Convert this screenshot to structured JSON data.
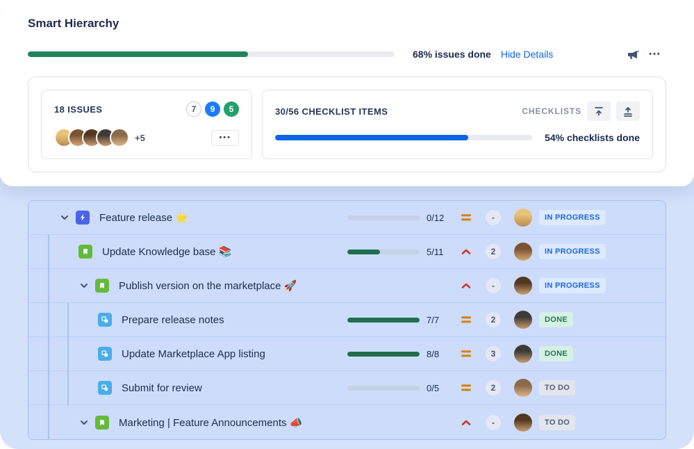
{
  "header": {
    "title": "Smart Hierarchy",
    "progress": {
      "bar_percent": 60,
      "label": "68% issues done"
    },
    "hide_details_label": "Hide Details",
    "more_label": "•••"
  },
  "summary": {
    "issues_card": {
      "title": "18 ISSUES",
      "status_badges": [
        {
          "value": "7",
          "style": "todo"
        },
        {
          "value": "9",
          "style": "inprogress"
        },
        {
          "value": "5",
          "style": "done"
        }
      ],
      "avatars": [
        "av1",
        "av2",
        "av3",
        "av4",
        "av5"
      ],
      "avatars_extra": "+5",
      "more_label": "•••"
    },
    "checklist_card": {
      "title": "30/56 CHECKLIST ITEMS",
      "checklists_label": "CHECKLISTS",
      "progress": {
        "bar_percent": 75,
        "label": "54% checklists done"
      }
    }
  },
  "table": {
    "rows": [
      {
        "depth": 0,
        "expandable": true,
        "type": "epic",
        "title": "Feature release ⭐",
        "show_progress": true,
        "progress": "0/12",
        "progress_percent": 0,
        "priority": "medium",
        "checklist_count": "-",
        "status_label": "IN PROGRESS",
        "status_style": "inprogress",
        "avatar": "av1"
      },
      {
        "depth": 1,
        "expandable": false,
        "type": "story",
        "title": "Update Knowledge base 📚",
        "show_progress": true,
        "progress": "5/11",
        "progress_percent": 45,
        "priority": "high",
        "checklist_count": "2",
        "status_label": "IN PROGRESS",
        "status_style": "inprogress",
        "avatar": "av2"
      },
      {
        "depth": 1,
        "expandable": true,
        "type": "story",
        "title": "Publish version on the marketplace 🚀",
        "show_progress": false,
        "progress": "",
        "progress_percent": 0,
        "priority": "high",
        "checklist_count": "-",
        "status_label": "IN PROGRESS",
        "status_style": "inprogress",
        "avatar": "av3"
      },
      {
        "depth": 2,
        "expandable": false,
        "type": "subtask",
        "title": "Prepare release notes",
        "show_progress": true,
        "progress": "7/7",
        "progress_percent": 100,
        "priority": "medium",
        "checklist_count": "2",
        "status_label": "DONE",
        "status_style": "done",
        "avatar": "av4"
      },
      {
        "depth": 2,
        "expandable": false,
        "type": "subtask",
        "title": "Update Marketplace App listing",
        "show_progress": true,
        "progress": "8/8",
        "progress_percent": 100,
        "priority": "medium",
        "checklist_count": "3",
        "status_label": "DONE",
        "status_style": "done",
        "avatar": "av4"
      },
      {
        "depth": 2,
        "expandable": false,
        "type": "subtask",
        "title": "Submit for review",
        "show_progress": true,
        "progress": "0/5",
        "progress_percent": 0,
        "priority": "medium",
        "checklist_count": "2",
        "status_label": "TO DO",
        "status_style": "todo",
        "avatar": "av5"
      },
      {
        "depth": 1,
        "expandable": true,
        "type": "story",
        "title": "Marketing | Feature Announcements 📣",
        "show_progress": false,
        "progress": "",
        "progress_percent": 0,
        "priority": "high",
        "checklist_count": "-",
        "status_label": "TO DO",
        "status_style": "todo",
        "avatar": "av3"
      }
    ]
  },
  "colors": {
    "background": "#d3e1fb",
    "issues_progress": "#1f845a",
    "checklist_progress": "#0c66e4",
    "row_progress": "#216e4e",
    "status_inprogress": "#1668e3",
    "status_done": "#1e7a52",
    "status_todo": "#505f79",
    "priority_medium": "#d97f08",
    "priority_high": "#c9372c",
    "epic_icon": "#4a63e8",
    "story_icon": "#63ba3c",
    "subtask_icon": "#4bade8"
  }
}
